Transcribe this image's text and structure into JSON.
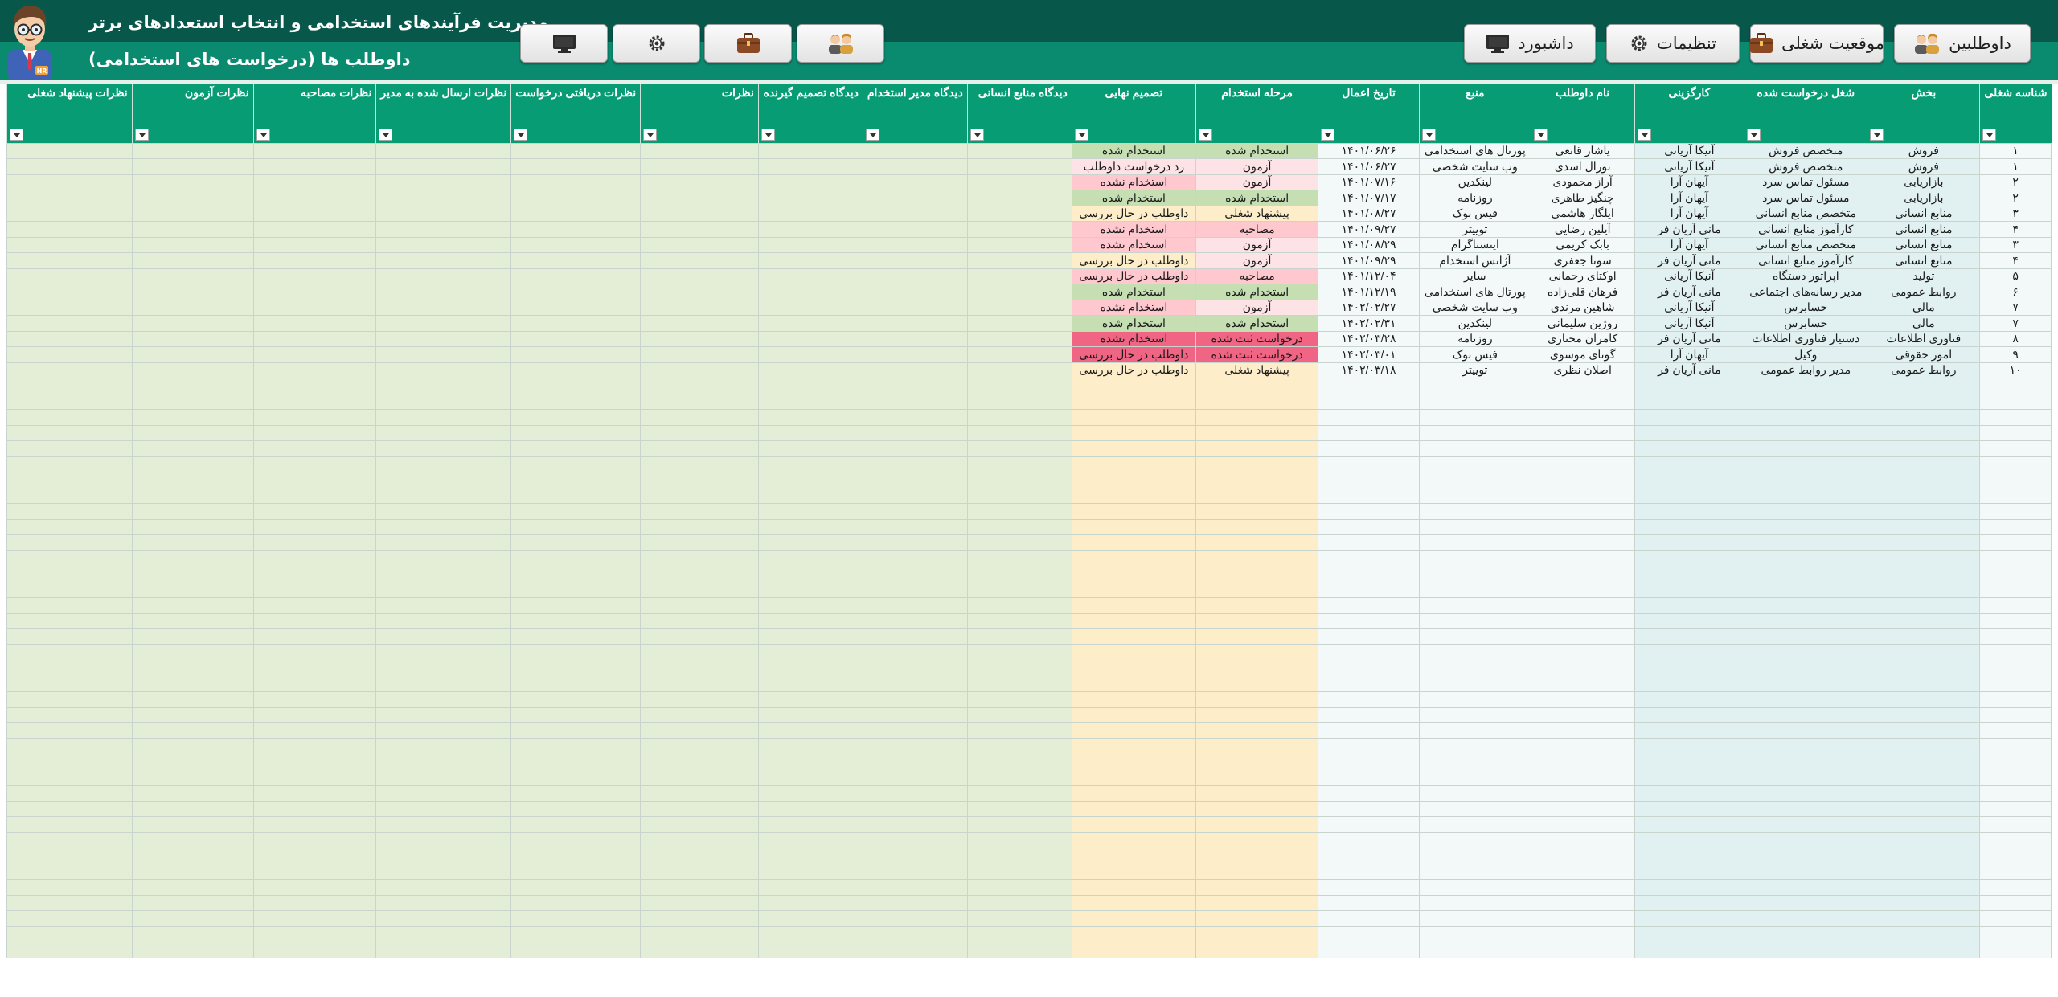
{
  "app": {
    "title": "مدیریت فرآیندهای استخدامی و انتخاب استعدادهای برتر",
    "subtitle": "داوطلب ها (درخواست های استخدامی)",
    "avatar_badge": "HR"
  },
  "nav": {
    "candidates_label": "داوطلبین",
    "positions_label": "موقعیت شغلی",
    "settings_label": "تنظیمات",
    "dashboard_label": "داشبورد"
  },
  "colors": {
    "header_dark": "#07574a",
    "header_light": "#0a8a6f",
    "column_header": "#089c74",
    "status_green": "#c5dfb3",
    "status_pink": "#ffc7ce",
    "status_red": "#f06584"
  },
  "table": {
    "columns": [
      "شناسه شغلی",
      "بخش",
      "شغل درخواست شده",
      "کارگزینی",
      "نام داوطلب",
      "منبع",
      "تاریخ اعمال",
      "مرحله استخدام",
      "تصمیم نهایی",
      "دیدگاه منابع انسانی",
      "دیدگاه مدیر استخدام",
      "دیدگاه تصمیم گیرنده",
      "نظرات",
      "نظرات دریافتی درخواست",
      "نظرات ارسال شده به مدیر",
      "نظرات مصاحبه",
      "نظرات آزمون",
      "نظرات پیشنهاد شغلی"
    ],
    "rows": [
      [
        "۱",
        "فروش",
        "متخصص فروش",
        "آنیکا آریانی",
        "یاشار قانعی",
        "پورتال های استخدامی",
        "۱۴۰۱/۰۶/۲۶",
        "استخدام شده",
        "استخدام شده"
      ],
      [
        "۱",
        "فروش",
        "متخصص فروش",
        "آنیکا آریانی",
        "تورال اسدی",
        "وب سایت شخصی",
        "۱۴۰۱/۰۶/۲۷",
        "آزمون",
        "رد درخواست داوطلب"
      ],
      [
        "۲",
        "بازاریابی",
        "مسئول تماس سرد",
        "آیهان آرا",
        "آراز محمودی",
        "لینکدین",
        "۱۴۰۱/۰۷/۱۶",
        "آزمون",
        "استخدام نشده"
      ],
      [
        "۲",
        "بازاریابی",
        "مسئول تماس سرد",
        "آیهان آرا",
        "چنگیز طاهری",
        "روزنامه",
        "۱۴۰۱/۰۷/۱۷",
        "استخدام شده",
        "استخدام شده"
      ],
      [
        "۳",
        "منابع انسانی",
        "متخصص منابع انسانی",
        "آیهان آرا",
        "ایلگار هاشمی",
        "فیس بوک",
        "۱۴۰۱/۰۸/۲۷",
        "پیشنهاد شغلی",
        "داوطلب در حال بررسی"
      ],
      [
        "۴",
        "منابع انسانی",
        "کارآموز منابع انسانی",
        "مانی آریان فر",
        "آیلین رضایی",
        "توییتر",
        "۱۴۰۱/۰۹/۲۷",
        "مصاحبه",
        "استخدام نشده"
      ],
      [
        "۳",
        "منابع انسانی",
        "متخصص منابع انسانی",
        "آیهان آرا",
        "بابک کریمی",
        "اینستاگرام",
        "۱۴۰۱/۰۸/۲۹",
        "آزمون",
        "استخدام نشده"
      ],
      [
        "۴",
        "منابع انسانی",
        "کارآموز منابع انسانی",
        "مانی آریان فر",
        "سونا جعفری",
        "آژانس استخدام",
        "۱۴۰۱/۰۹/۲۹",
        "آزمون",
        "داوطلب در حال بررسی"
      ],
      [
        "۵",
        "تولید",
        "اپراتور دستگاه",
        "آنیکا آریانی",
        "اوکتای رحمانی",
        "سایر",
        "۱۴۰۱/۱۲/۰۴",
        "مصاحبه",
        "داوطلب در حال بررسی"
      ],
      [
        "۶",
        "روابط عمومی",
        "مدیر رسانه‌های اجتماعی",
        "مانی آریان فر",
        "فرهان قلی‌زاده",
        "پورتال های استخدامی",
        "۱۴۰۱/۱۲/۱۹",
        "استخدام شده",
        "استخدام شده"
      ],
      [
        "۷",
        "مالی",
        "حسابرس",
        "آنیکا آریانی",
        "شاهین مرندی",
        "وب سایت شخصی",
        "۱۴۰۲/۰۲/۲۷",
        "آزمون",
        "استخدام نشده"
      ],
      [
        "۷",
        "مالی",
        "حسابرس",
        "آنیکا آریانی",
        "روژین سلیمانی",
        "لینکدین",
        "۱۴۰۲/۰۲/۳۱",
        "استخدام شده",
        "استخدام شده"
      ],
      [
        "۸",
        "فناوری اطلاعات",
        "دستیار فناوری اطلاعات",
        "مانی آریان فر",
        "کامران مختاری",
        "روزنامه",
        "۱۴۰۲/۰۳/۲۸",
        "درخواست ثبت شده",
        "استخدام نشده"
      ],
      [
        "۹",
        "امور حقوقی",
        "وکیل",
        "آیهان آرا",
        "گونای موسوی",
        "فیس بوک",
        "۱۴۰۲/۰۳/۰۱",
        "درخواست ثبت شده",
        "داوطلب در حال بررسی"
      ],
      [
        "۱۰",
        "روابط عمومی",
        "مدیر روابط عمومی",
        "مانی آریان فر",
        "اصلان نظری",
        "توییتر",
        "۱۴۰۲/۰۳/۱۸",
        "پیشنهاد شغلی",
        "داوطلب در حال بررسی"
      ]
    ]
  }
}
